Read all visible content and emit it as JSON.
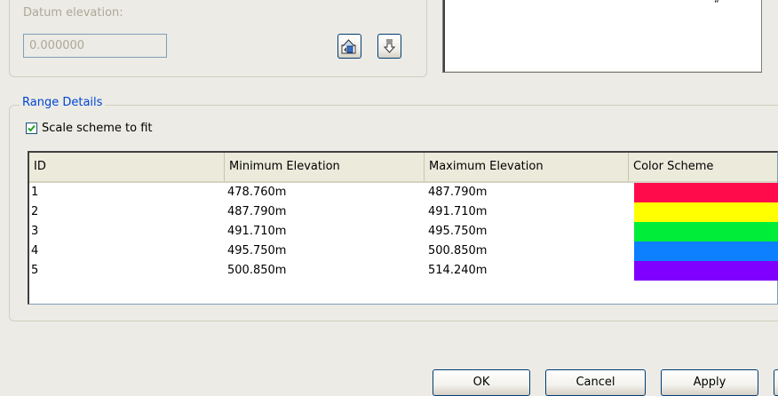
{
  "datum": {
    "label": "Datum elevation:",
    "value": "0.000000",
    "import_icon": "import-from-surface-icon",
    "download_icon": "download-arrow-icon"
  },
  "range": {
    "title": "Range Details",
    "scale_checkbox_label": "Scale scheme to fit",
    "scale_checked": true
  },
  "table": {
    "columns": [
      "ID",
      "Minimum Elevation",
      "Maximum Elevation",
      "Color Scheme"
    ],
    "rows": [
      {
        "id": "1",
        "min": "478.760m",
        "max": "487.790m",
        "color": "#ff0a4b"
      },
      {
        "id": "2",
        "min": "487.790m",
        "max": "491.710m",
        "color": "#ffff00"
      },
      {
        "id": "3",
        "min": "491.710m",
        "max": "495.750m",
        "color": "#00ee3a"
      },
      {
        "id": "4",
        "min": "495.750m",
        "max": "500.850m",
        "color": "#0c80ff"
      },
      {
        "id": "5",
        "min": "500.850m",
        "max": "514.240m",
        "color": "#8000ff"
      }
    ]
  },
  "footer": {
    "ok_label": "OK",
    "cancel_label": "Cancel",
    "apply_label": "Apply"
  }
}
